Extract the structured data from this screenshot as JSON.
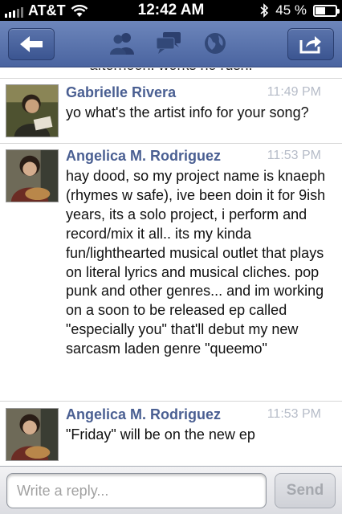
{
  "status_bar": {
    "carrier": "AT&T",
    "time": "12:42 AM",
    "battery": "45 %",
    "battery_level": 0.45
  },
  "nav": {
    "back_icon": "back-arrow-icon",
    "icons": [
      "friends-icon",
      "messages-icon",
      "globe-icon"
    ],
    "share_icon": "share-icon",
    "bar_color": "#5a73ab"
  },
  "messages": {
    "partial_text": "afternoon. works no rush.",
    "items": [
      {
        "name": "Gabrielle Rivera",
        "time": "11:49 PM",
        "text": "yo what's the artist info for your song?"
      },
      {
        "name": "Angelica M. Rodriguez",
        "time": "11:53 PM",
        "text": "hay dood, so my project name is knaeph (rhymes w safe), ive been doin it for 9ish years, its a solo project, i perform and record/mix it all.. its my kinda fun/lighthearted musical outlet that plays on literal lyrics and musical  cliches. pop punk and other genres... and im working on a soon to be released ep called \"especially you\" that'll debut my new sarcasm laden genre \"queemo\""
      },
      {
        "name": "Angelica M. Rodriguez",
        "time": "11:53 PM",
        "text": "\"Friday\" will be on the new ep"
      }
    ]
  },
  "reply": {
    "placeholder": "Write a reply...",
    "send_label": "Send"
  },
  "colors": {
    "name": "#4a5f92",
    "time": "#b6bcc8",
    "nav": "#4a64a0"
  }
}
